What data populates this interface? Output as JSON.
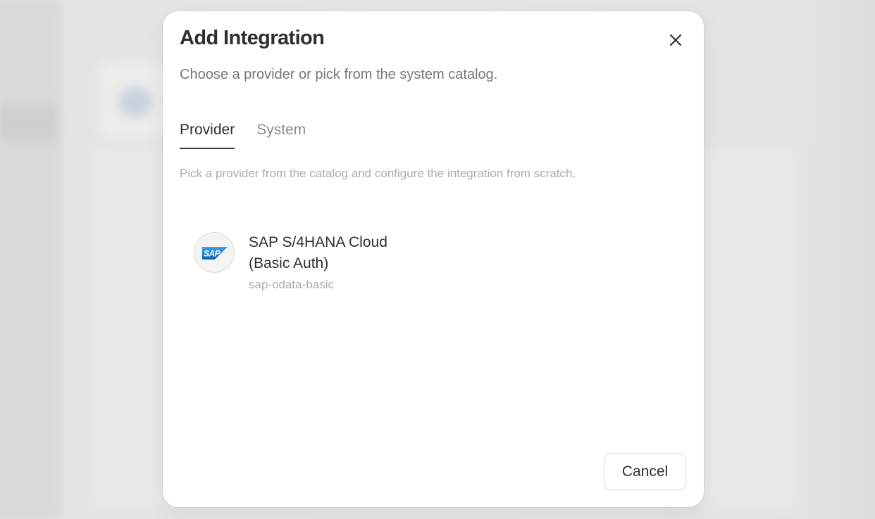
{
  "dialog": {
    "title": "Add Integration",
    "subtitle": "Choose a provider or pick from the system catalog.",
    "close_icon": "close-icon"
  },
  "tabs": [
    {
      "label": "Provider",
      "active": true
    },
    {
      "label": "System",
      "active": false
    }
  ],
  "provider_tab": {
    "description": "Pick a provider from the catalog and configure the integration from scratch.",
    "providers": [
      {
        "name": "SAP S/4HANA Cloud (Basic Auth)",
        "slug": "sap-odata-basic",
        "logo_icon": "sap-logo-icon",
        "logo_text": "SAP",
        "logo_color": "#1a73c8"
      }
    ]
  },
  "footer": {
    "cancel_label": "Cancel"
  }
}
